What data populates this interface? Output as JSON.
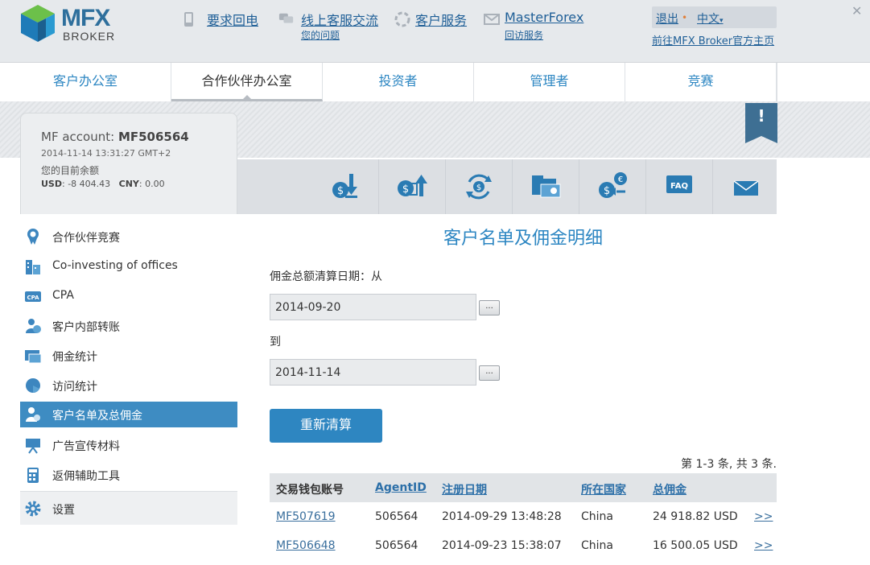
{
  "logo": {
    "main": "MFX",
    "sub": "BROKER"
  },
  "header": {
    "callback": {
      "label": "要求回电",
      "icon": "phone-icon"
    },
    "chat": {
      "label": "线上客服交流",
      "sub": "您的问题",
      "icon": "chat-icon"
    },
    "support": {
      "label": "客户服务",
      "icon": "support-icon"
    },
    "email": {
      "label": "MasterForex",
      "sub": "回访服务",
      "icon": "mail-icon"
    },
    "logout": "退出",
    "language": "中文",
    "goto_main": "前往MFX Broker官方主页"
  },
  "nav": {
    "tabs": [
      {
        "label": "客户办公室"
      },
      {
        "label": "合作伙伴办公室"
      },
      {
        "label": "投资者"
      },
      {
        "label": "管理者"
      },
      {
        "label": "竞赛"
      }
    ],
    "active": "合作伙伴办公室"
  },
  "notice_flag": "!",
  "account": {
    "label": "MF account:",
    "id": "MF506564",
    "datetime": "2014-11-14 13:31:27 GMT+2",
    "balance_label": "您的目前余额",
    "usd_label": "USD",
    "usd_value": ": -8 404.43",
    "cny_label": "CNY",
    "cny_value": ": 0.00"
  },
  "toolbar": {
    "icons": [
      "deposit-icon",
      "withdraw-icon",
      "transfer-icon",
      "wallet-icon",
      "exchange-icon",
      "faq-icon",
      "message-icon"
    ],
    "faq_text": "FAQ"
  },
  "sidebar": {
    "items": [
      {
        "label": "合作伙伴竞赛",
        "icon": "award-icon"
      },
      {
        "label": "Co-investing of offices",
        "icon": "buildings-icon"
      },
      {
        "label": "CPA",
        "icon": "cpa-icon",
        "icon_text": "CPA"
      },
      {
        "label": "客户内部转账",
        "icon": "user-transfer-icon"
      },
      {
        "label": "佣金统计",
        "icon": "stats-icon"
      },
      {
        "label": "访问统计",
        "icon": "globe-icon"
      },
      {
        "label": "客户名单及总佣金",
        "icon": "client-list-icon"
      },
      {
        "label": "广告宣传材料",
        "icon": "presentation-icon"
      },
      {
        "label": "返佣辅助工具",
        "icon": "calculator-icon"
      },
      {
        "label": "设置",
        "icon": "gear-icon"
      }
    ],
    "active": "客户名单及总佣金"
  },
  "main": {
    "title": "客户名单及佣金明细",
    "from_label": "佣金总额清算日期：从",
    "from_date": "2014-09-20",
    "to_label": "到",
    "to_date": "2014-11-14",
    "picker_label": "...",
    "recalc_label": "重新清算",
    "paging": "第 1-3 条, 共 3 条."
  },
  "table": {
    "headers": [
      "交易钱包账号",
      "AgentID",
      "注册日期",
      "所在国家",
      "总佣金"
    ],
    "rows": [
      {
        "account": "MF507619",
        "agent": "506564",
        "date": "2014-09-29 13:48:28",
        "country": "China",
        "commission": "24 918.82 USD",
        "more": ">>"
      },
      {
        "account": "MF506648",
        "agent": "506564",
        "date": "2014-09-23 15:38:07",
        "country": "China",
        "commission": "16 500.05 USD",
        "more": ">>"
      }
    ]
  },
  "colors": {
    "accent": "#2e86c1",
    "link": "#1f5f97",
    "active_sidebar": "#3e8cc2",
    "header_bg": "#e6e9ec"
  }
}
